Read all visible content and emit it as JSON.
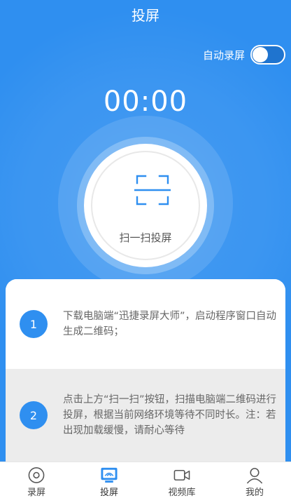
{
  "header": {
    "title": "投屏"
  },
  "auto_record": {
    "label": "自动录屏",
    "enabled": false
  },
  "timer": {
    "value": "00:00"
  },
  "scan": {
    "label": "扫一扫投屏",
    "icon": "scan-frame-icon"
  },
  "steps": [
    {
      "number": "1",
      "text": "下载电脑端“迅捷录屏大师”，启动程序窗口自动生成二维码；"
    },
    {
      "number": "2",
      "text": "点击上方“扫一扫”按钮，扫描电脑端二维码进行投屏，根据当前网络环境等待不同时长。注：若出现加载缓慢，请耐心等待"
    }
  ],
  "tabs": [
    {
      "label": "录屏",
      "icon": "record-disc-icon",
      "active": false
    },
    {
      "label": "投屏",
      "icon": "screencast-icon",
      "active": true
    },
    {
      "label": "视频库",
      "icon": "video-camera-icon",
      "active": false
    },
    {
      "label": "我的",
      "icon": "user-icon",
      "active": false
    }
  ],
  "colors": {
    "primary": "#2f8ff0",
    "background_blue": "#2f8ff0",
    "step_bg": "#ececec"
  }
}
